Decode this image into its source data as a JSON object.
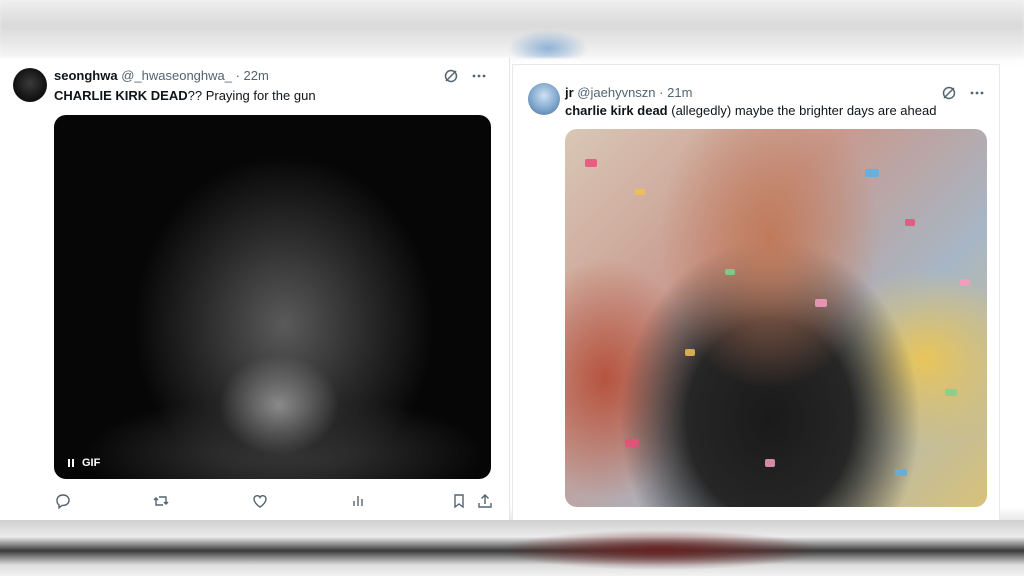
{
  "tweets": [
    {
      "display_name": "seonghwa",
      "handle": "@_hwaseonghwa_",
      "time": "· 22m",
      "text_bold": "CHARLIE KIRK DEAD",
      "text_rest": "?? Praying for the gun",
      "media_badge": "GIF",
      "icons": [
        "grok-icon",
        "more-icon",
        "reply-icon",
        "retweet-icon",
        "like-icon",
        "views-icon",
        "bookmark-icon",
        "share-icon"
      ]
    },
    {
      "display_name": "jr",
      "handle": "@jaehyvnszn",
      "time": "· 21m",
      "text_bold": "charlie kirk dead",
      "text_rest": " (allegedly) maybe the brighter days are ahead",
      "icons": [
        "grok-icon",
        "more-icon"
      ]
    }
  ],
  "colors": {
    "text_primary": "#0f1419",
    "text_secondary": "#536471",
    "icon": "#536471"
  }
}
